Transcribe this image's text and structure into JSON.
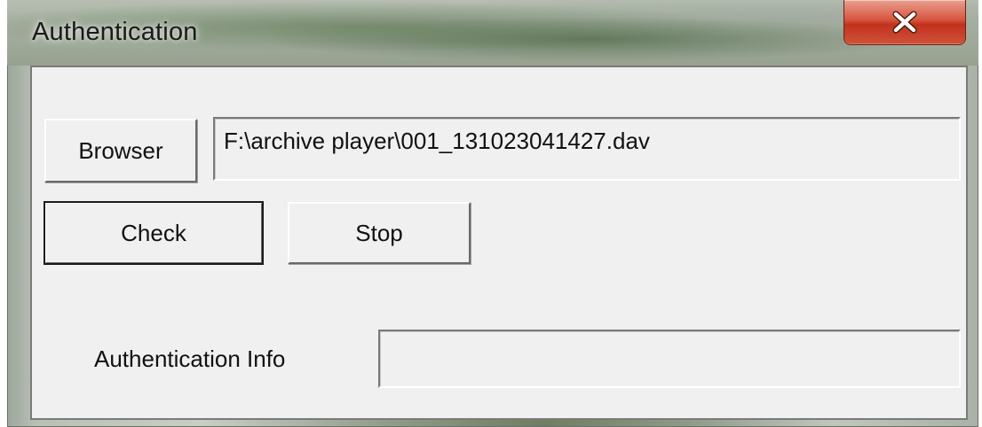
{
  "window": {
    "title": "Authentication"
  },
  "titlebar": {
    "close_icon": "close-x-icon",
    "close_color": "#c8391f"
  },
  "file": {
    "browse_label": "Browser",
    "path_value": "F:\\archive player\\001_131023041427.dav"
  },
  "actions": {
    "check_label": "Check",
    "stop_label": "Stop"
  },
  "auth_info": {
    "label": "Authentication Info",
    "value": ""
  }
}
